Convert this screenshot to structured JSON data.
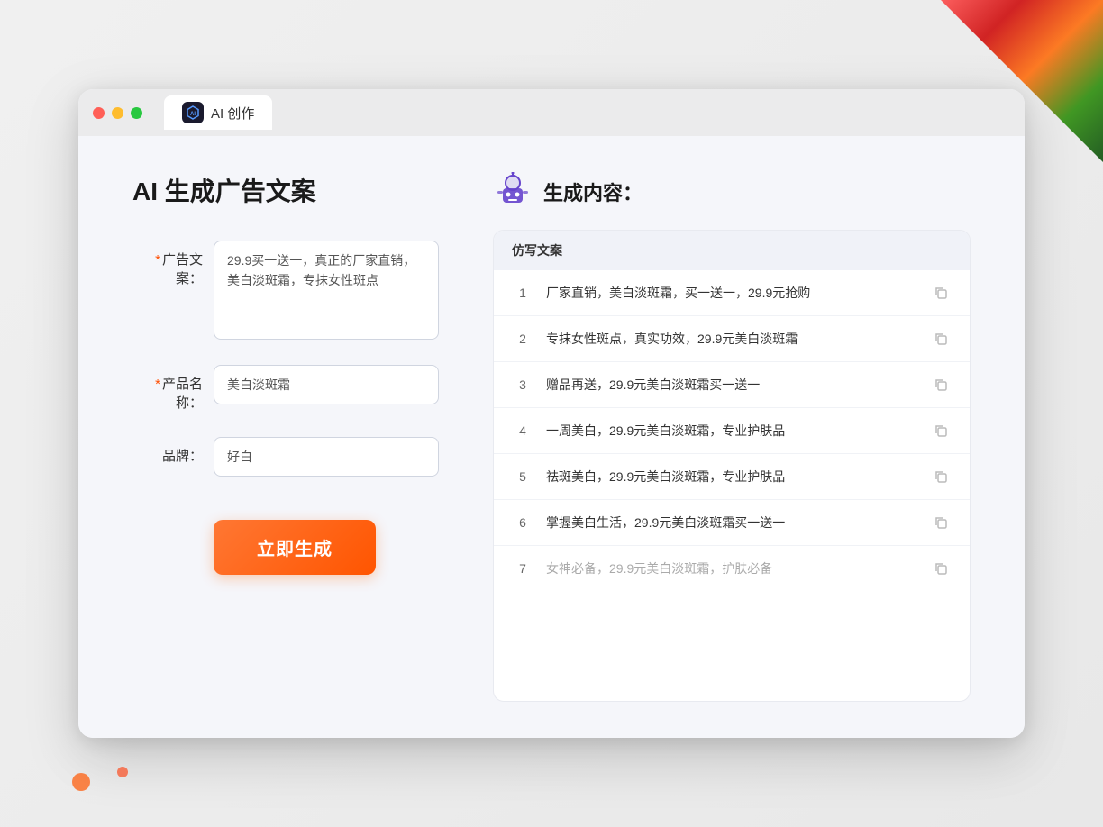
{
  "window": {
    "tab_label": "AI 创作"
  },
  "header": {
    "page_title": "AI 生成广告文案",
    "result_title": "生成内容："
  },
  "form": {
    "ad_copy_label": "广告文案：",
    "ad_copy_required": "*",
    "ad_copy_value": "29.9买一送一，真正的厂家直销，美白淡斑霜，专抹女性斑点",
    "product_name_label": "产品名称：",
    "product_name_required": "*",
    "product_name_value": "美白淡斑霜",
    "brand_label": "品牌：",
    "brand_value": "好白",
    "generate_btn_label": "立即生成"
  },
  "results": {
    "table_header": "仿写文案",
    "items": [
      {
        "num": "1",
        "text": "厂家直销，美白淡斑霜，买一送一，29.9元抢购",
        "muted": false
      },
      {
        "num": "2",
        "text": "专抹女性斑点，真实功效，29.9元美白淡斑霜",
        "muted": false
      },
      {
        "num": "3",
        "text": "赠品再送，29.9元美白淡斑霜买一送一",
        "muted": false
      },
      {
        "num": "4",
        "text": "一周美白，29.9元美白淡斑霜，专业护肤品",
        "muted": false
      },
      {
        "num": "5",
        "text": "祛斑美白，29.9元美白淡斑霜，专业护肤品",
        "muted": false
      },
      {
        "num": "6",
        "text": "掌握美白生活，29.9元美白淡斑霜买一送一",
        "muted": false
      },
      {
        "num": "7",
        "text": "女神必备，29.9元美白淡斑霜，护肤必备",
        "muted": true
      }
    ]
  }
}
